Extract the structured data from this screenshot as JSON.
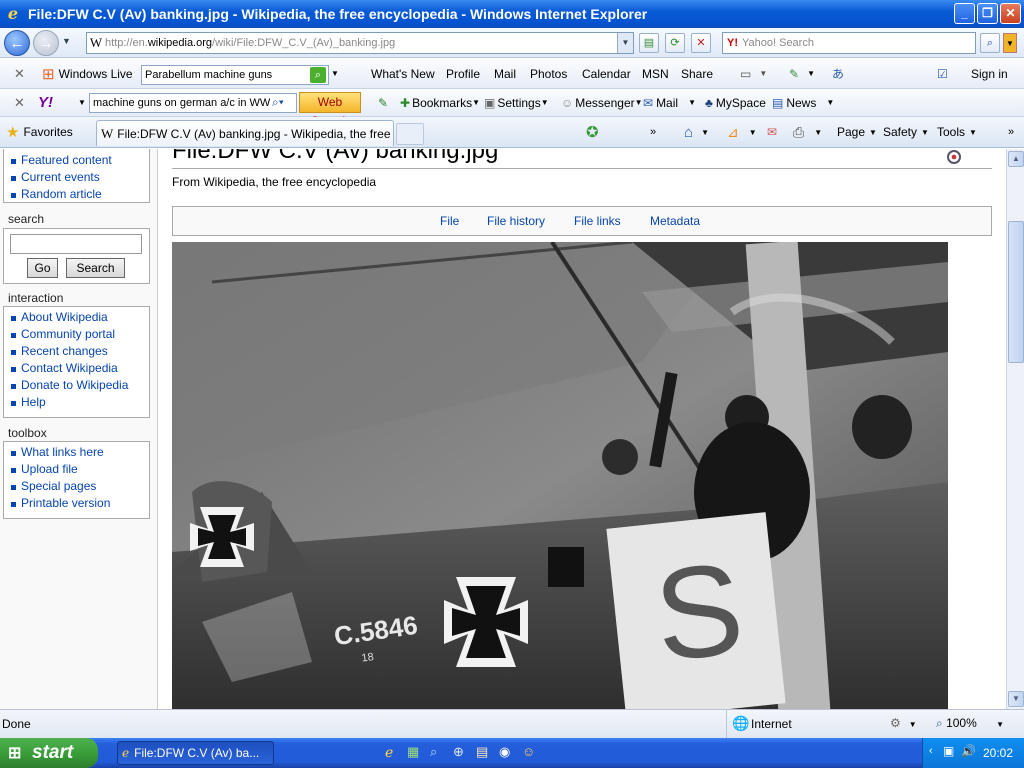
{
  "window": {
    "title": "File:DFW C.V (Av) banking.jpg - Wikipedia, the free encyclopedia - Windows Internet Explorer"
  },
  "address": {
    "url_prefix": "http://en.",
    "url_domain": "wikipedia.org",
    "url_path": "/wiki/File:DFW_C.V_(Av)_banking.jpg",
    "search_placeholder": "Yahoo! Search"
  },
  "windows_live_bar": {
    "brand": "Windows Live",
    "search_value": "Parabellum machine guns",
    "links": [
      "What's New",
      "Profile",
      "Mail",
      "Photos",
      "Calendar",
      "MSN",
      "Share"
    ],
    "sign_in": "Sign in"
  },
  "yahoo_bar": {
    "logo": "Y!",
    "search_value": "machine guns on german a/c in WW",
    "web_search": "Web Search",
    "bookmarks": "Bookmarks",
    "settings": "Settings",
    "messenger": "Messenger",
    "mail": "Mail",
    "myspace": "MySpace",
    "news": "News"
  },
  "tabs_bar": {
    "favorites": "Favorites",
    "active_tab": "File:DFW C.V (Av) banking.jpg - Wikipedia, the free e...",
    "page": "Page",
    "safety": "Safety",
    "tools": "Tools"
  },
  "sidebar": {
    "navigation": [
      "Featured content",
      "Current events",
      "Random article"
    ],
    "search_title": "search",
    "go": "Go",
    "search": "Search",
    "interaction_title": "interaction",
    "interaction": [
      "About Wikipedia",
      "Community portal",
      "Recent changes",
      "Contact Wikipedia",
      "Donate to Wikipedia",
      "Help"
    ],
    "toolbox_title": "toolbox",
    "toolbox": [
      "What links here",
      "Upload file",
      "Special pages",
      "Printable version"
    ]
  },
  "main": {
    "heading": "File:DFW C.V (Av) banking.jpg",
    "tagline": "From Wikipedia, the free encyclopedia",
    "file_tabs": [
      "File",
      "File history",
      "File links",
      "Metadata"
    ],
    "photo": {
      "serial": "C.5846",
      "serial_small": "18",
      "letter": "S"
    }
  },
  "statusbar": {
    "status": "Done",
    "zone": "Internet",
    "zoom": "100%"
  },
  "taskbar": {
    "start": "start",
    "item": "File:DFW C.V (Av) ba...",
    "clock": "20:02"
  },
  "colors": {
    "link": "#0645ad",
    "titlebar": "#0553d0",
    "taskbar": "#245edb",
    "start": "#379a37"
  }
}
